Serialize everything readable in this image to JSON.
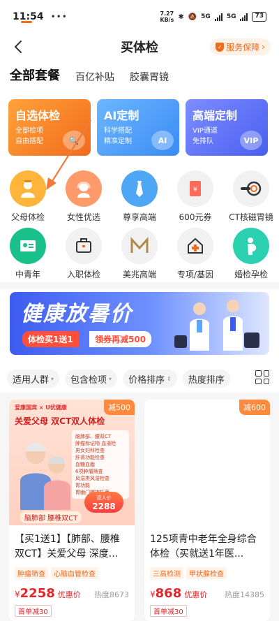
{
  "status_bar": {
    "time": "11:54",
    "dots": "•••",
    "net_speed_value": "7.27",
    "net_speed_unit": "KB/s",
    "sig1": "5G",
    "sig2": "5G",
    "battery": "73"
  },
  "header": {
    "title": "买体检",
    "service_label": "服务保障"
  },
  "tabs": [
    {
      "label": "全部套餐"
    },
    {
      "label": "百亿补贴"
    },
    {
      "label": "胶囊胃镜"
    }
  ],
  "feature_cards": [
    {
      "title": "自选体检",
      "line1": "全部检项",
      "line2": "自由搭配",
      "color": "#f26b1d"
    },
    {
      "title": "AI定制",
      "line1": "科学搭配",
      "line2": "精准定制",
      "badge": "AI",
      "color": "#3a8cf5"
    },
    {
      "title": "高端定制",
      "line1": "VIP通道",
      "line2": "免排队",
      "badge": "VIP",
      "color": "#4a5ff0"
    }
  ],
  "categories": [
    {
      "label": "父母体检",
      "icon": "elder-icon"
    },
    {
      "label": "女性优选",
      "icon": "woman-icon"
    },
    {
      "label": "尊享高端",
      "icon": "tie-icon"
    },
    {
      "label": "600元券",
      "icon": "coupon-icon"
    },
    {
      "label": "CT核磁胃镜",
      "icon": "ct-scan-icon"
    },
    {
      "label": "中青年",
      "icon": "id-card-icon"
    },
    {
      "label": "入职体检",
      "icon": "briefcase-icon"
    },
    {
      "label": "美兆高端",
      "icon": "m-logo-icon"
    },
    {
      "label": "专项/基因",
      "icon": "medical-house-icon"
    },
    {
      "label": "婚检孕检",
      "icon": "pregnant-icon"
    }
  ],
  "banner": {
    "title": "健康放暑价",
    "pill1": "体检买1送1",
    "pill2": "领券再减500"
  },
  "filters": [
    {
      "label": "适用人群",
      "suffix": "▾"
    },
    {
      "label": "包含检项",
      "suffix": "▾"
    },
    {
      "label": "价格排序",
      "suffix": "⇕"
    },
    {
      "label": "热度排序",
      "suffix": ""
    }
  ],
  "products": [
    {
      "discount": "减500",
      "image": {
        "brand": "爱康国宾 × U优健康",
        "headline": "关爱父母 双CT双人体检",
        "items": [
          "脑肺部、腰双CT",
          "肿瘤标记物 血液检",
          "男女妇科检查",
          "肝肾功能检查",
          "血糖血脂",
          "6项肿瘤筛查",
          "风湿类风湿检查",
          "胃功能",
          "胃幽门螺旋杆菌"
        ],
        "price_label": "双人价",
        "price": "2288",
        "ribbon": "脑肺部 腰椎双CT"
      },
      "name": "【买1送1】【肺部、腰椎双CT】关爱父母 深度...",
      "tags": [
        "肿瘤筛查",
        "心脑血管检查"
      ],
      "currency": "¥",
      "price": "2258",
      "price_label": "优惠价",
      "heat": "热度8673",
      "first_order": "首单减30"
    },
    {
      "discount": "减600",
      "name": "125项青中老年全身综合体检（买就送1年医...",
      "tags": [
        "三高检测",
        "甲状腺检查"
      ],
      "currency": "¥",
      "price": "868",
      "price_label": "优惠价",
      "heat": "热度14385",
      "first_order": "首单减30"
    }
  ],
  "colors": {
    "accent": "#f26b1d",
    "price_red": "#e3262b"
  }
}
